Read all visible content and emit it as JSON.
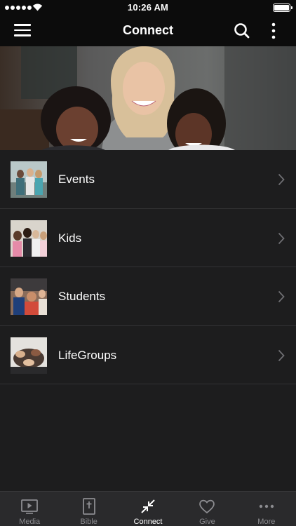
{
  "status_bar": {
    "time": "10:26 AM"
  },
  "nav": {
    "title": "Connect"
  },
  "list": [
    {
      "label": "Events"
    },
    {
      "label": "Kids"
    },
    {
      "label": "Students"
    },
    {
      "label": "LifeGroups"
    }
  ],
  "tabs": [
    {
      "label": "Media",
      "icon": "play-icon"
    },
    {
      "label": "Bible",
      "icon": "bible-icon"
    },
    {
      "label": "Connect",
      "icon": "connect-icon",
      "active": true
    },
    {
      "label": "Give",
      "icon": "heart-icon"
    },
    {
      "label": "More",
      "icon": "more-dots-icon"
    }
  ],
  "colors": {
    "background": "#1d1d1e",
    "bar": "#0c0c0c",
    "tab_bar": "#2a2a2c",
    "tab_inactive": "#8c8c90",
    "tab_active": "#ffffff"
  }
}
